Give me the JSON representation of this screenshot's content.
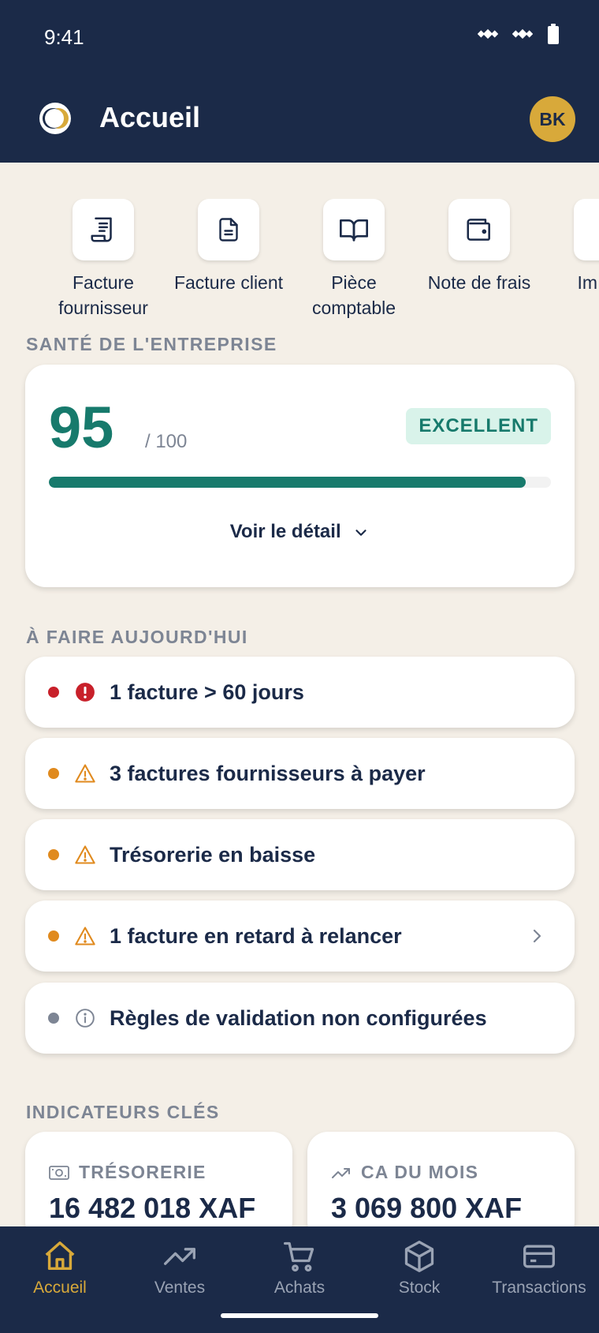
{
  "status_bar": {
    "time": "9:41"
  },
  "app_bar": {
    "title": "Accueil",
    "avatar_initials": "BK"
  },
  "quick_actions": [
    {
      "label": "Facture fournisseur",
      "icon": "receipt-icon"
    },
    {
      "label": "Facture client",
      "icon": "document-icon"
    },
    {
      "label": "Pièce comptable",
      "icon": "book-icon"
    },
    {
      "label": "Note de frais",
      "icon": "wallet-icon"
    },
    {
      "label": "Im doc",
      "icon": "import-icon"
    }
  ],
  "health": {
    "section_title": "SANTÉ DE L'ENTREPRISE",
    "score": "95",
    "score_max": "/ 100",
    "badge": "EXCELLENT",
    "progress_fraction": 0.95,
    "detail_label": "Voir le détail"
  },
  "todo": {
    "section_title": "À FAIRE AUJOURD'HUI",
    "items": [
      {
        "text": "1 facture > 60 jours",
        "level": "error",
        "icon": "alert-circle-icon"
      },
      {
        "text": "3 factures fournisseurs à payer",
        "level": "warning",
        "icon": "warning-triangle-icon"
      },
      {
        "text": "Trésorerie en baisse",
        "level": "warning",
        "icon": "warning-triangle-icon"
      },
      {
        "text": "1 facture en retard à relancer",
        "level": "warning",
        "icon": "warning-triangle-icon"
      },
      {
        "text": "Règles de validation non configurées",
        "level": "info",
        "icon": "info-circle-icon"
      }
    ]
  },
  "kpis": {
    "section_title": "INDICATEURS CLÉS",
    "items": [
      {
        "label": "TRÉSORERIE",
        "value": "16 482 018 XAF",
        "icon": "cash-icon"
      },
      {
        "label": "CA DU MOIS",
        "value": "3 069 800 XAF",
        "icon": "trend-up-icon"
      }
    ]
  },
  "bottom_nav": {
    "items": [
      {
        "label": "Accueil",
        "icon": "home-icon",
        "active": true
      },
      {
        "label": "Ventes",
        "icon": "trend-up-icon",
        "active": false
      },
      {
        "label": "Achats",
        "icon": "cart-icon",
        "active": false
      },
      {
        "label": "Stock",
        "icon": "box-icon",
        "active": false
      },
      {
        "label": "Transactions",
        "icon": "card-icon",
        "active": false
      }
    ]
  },
  "colors": {
    "navy": "#1b2a48",
    "background": "#f4efe7",
    "accent_gold": "#d8a93a",
    "health_green": "#177a6c",
    "error": "#c8202a",
    "warning": "#e08a1e",
    "info": "#7d8594"
  }
}
